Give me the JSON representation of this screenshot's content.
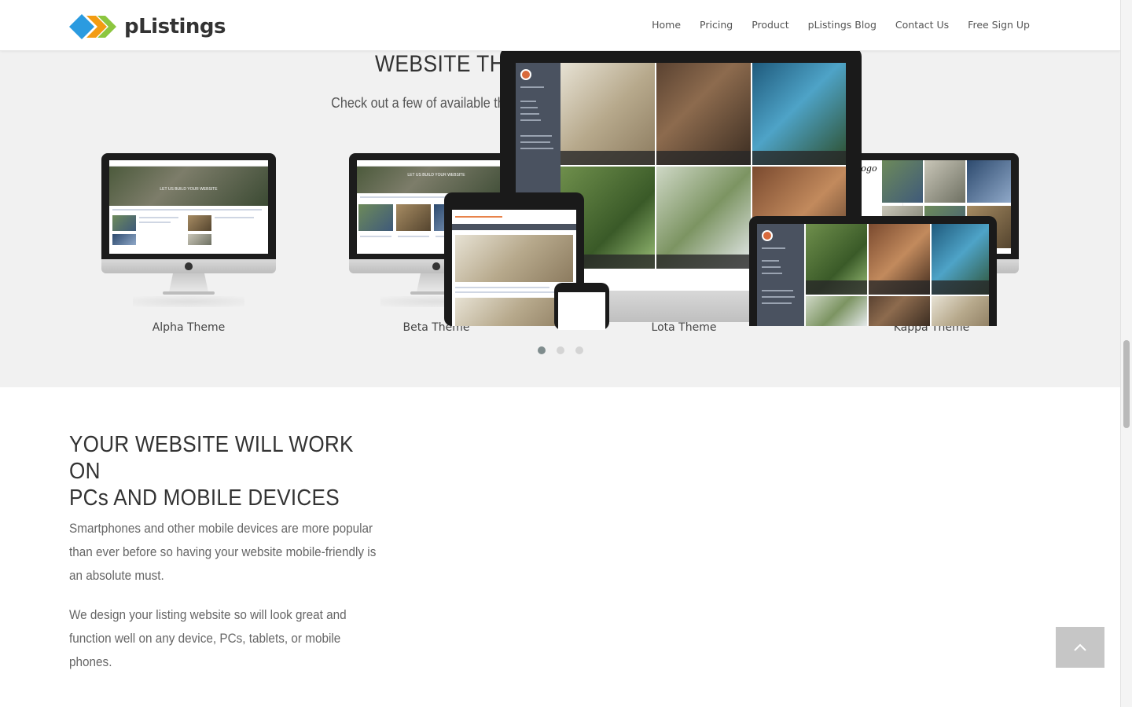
{
  "header": {
    "brand": "pListings",
    "nav": [
      "Home",
      "Pricing",
      "Product",
      "pListings Blog",
      "Contact Us",
      "Free Sign Up"
    ]
  },
  "themes": {
    "title": "WEBSITE THEME DESIGN SAMPLES",
    "subtitle": "Check out a few of available themes that you can use for your own listing website",
    "items": [
      {
        "label": "Alpha Theme"
      },
      {
        "label": "Beta Theme"
      },
      {
        "label": "Lota Theme"
      },
      {
        "label": "Kappa Theme"
      }
    ],
    "carousel": {
      "pages": 3,
      "active": 1
    }
  },
  "mobile": {
    "title_line1": "YOUR WEBSITE WILL WORK ON",
    "title_line2": "PCs AND MOBILE DEVICES",
    "paragraph1": "Smartphones and other mobile devices are more popular than ever before so having your website mobile-friendly is an absolute must.",
    "paragraph2": "We design your listing website so will look great and function well on any device, PCs, tablets, or mobile phones."
  },
  "colors": {
    "section_bg": "#f1f1f1",
    "brand_blue": "#2b9be0",
    "brand_orange": "#f39c12",
    "brand_green": "#8cc63f",
    "dot_active": "#7f8c8d",
    "to_top_bg": "#c6c6c6"
  },
  "icons": {
    "logo": "plistings-logo-icon",
    "to_top": "chevron-up-icon"
  }
}
